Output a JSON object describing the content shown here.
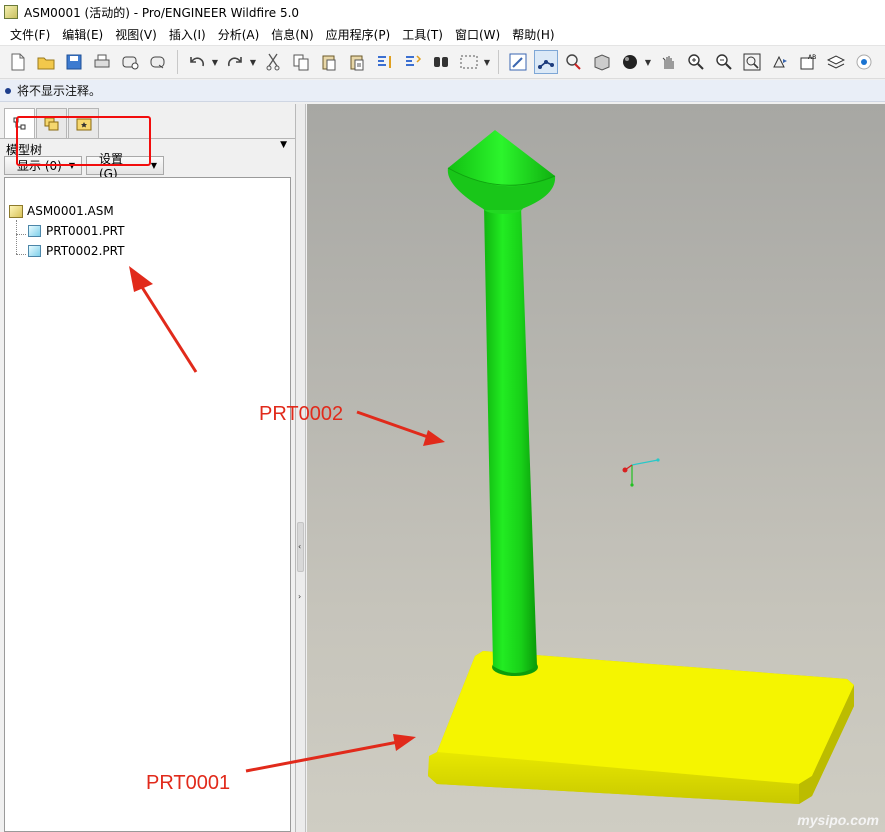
{
  "window": {
    "title": "ASM0001 (活动的) - Pro/ENGINEER Wildfire 5.0"
  },
  "menubar": {
    "items": [
      "文件(F)",
      "编辑(E)",
      "视图(V)",
      "插入(I)",
      "分析(A)",
      "信息(N)",
      "应用程序(P)",
      "工具(T)",
      "窗口(W)",
      "帮助(H)"
    ]
  },
  "toolbar": {
    "icons": [
      "new-file-icon",
      "open-folder-icon",
      "save-icon",
      "print-icon",
      "send-mail-icon",
      "email-attach-icon",
      "undo-icon",
      "redo-icon",
      "cut-icon",
      "copy-icon",
      "paste-icon",
      "paste-special-icon",
      "regenerate-icon",
      "regenerate-manager-icon",
      "find-icon",
      "select-box-icon",
      "repaint-icon",
      "spin-center-icon",
      "orient-mode-icon",
      "saved-views-icon",
      "shading-icon",
      "pan-zoom-icon",
      "zoom-in-icon",
      "zoom-out-icon",
      "refit-icon",
      "reorient-icon",
      "annotation-icon",
      "layers-icon",
      "display-style-icon"
    ]
  },
  "message": {
    "text": "将不显示注释。"
  },
  "left_panel": {
    "title": "模型树",
    "buttons": {
      "show": "显示 (0)",
      "settings": "设置 (G)"
    },
    "tree": {
      "root": "ASM0001.ASM",
      "children": [
        "PRT0001.PRT",
        "PRT0002.PRT"
      ]
    }
  },
  "annotations": {
    "prt0002_label": "PRT0002",
    "prt0001_label": "PRT0001"
  },
  "colors": {
    "highlight_red": "#f20d0d",
    "annotation_red": "#e12a1b",
    "part_green": "#1ee51e",
    "part_yellow": "#f5f500"
  },
  "watermark": "mysipo.com"
}
